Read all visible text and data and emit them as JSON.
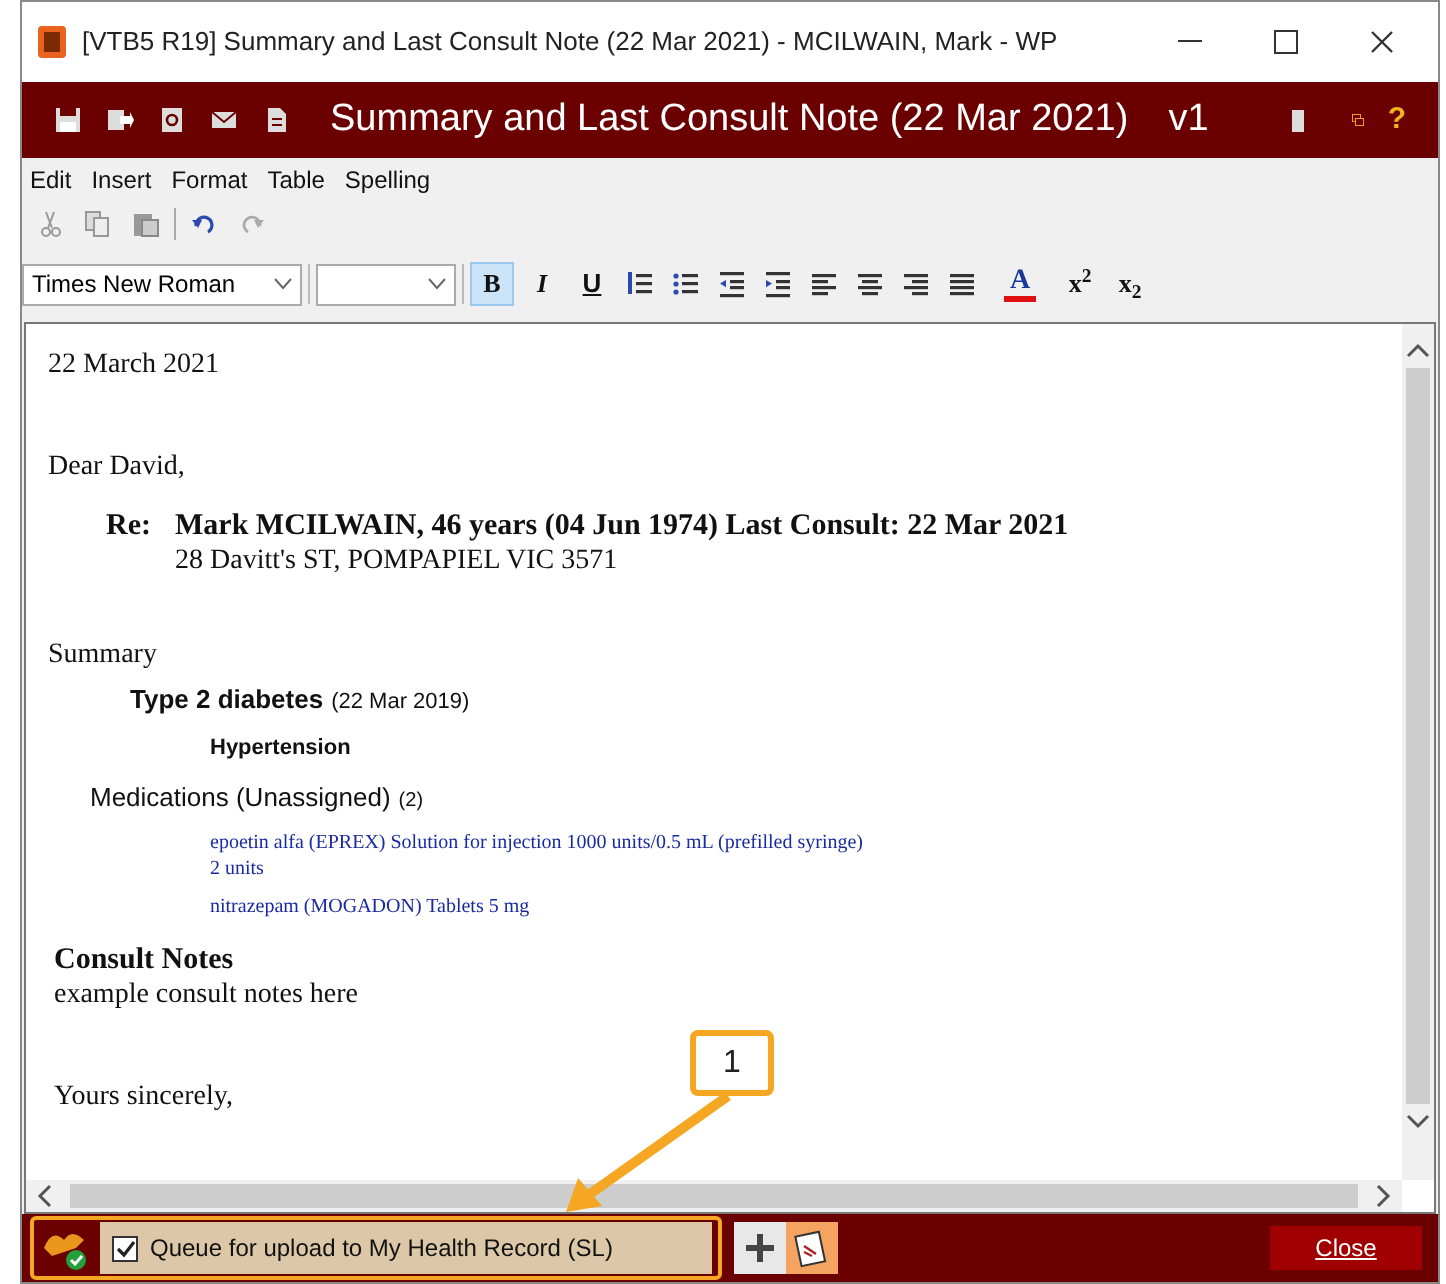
{
  "window": {
    "title": "[VTB5 R19] Summary and Last Consult Note (22 Mar 2021) - MCILWAIN, Mark - WP"
  },
  "header": {
    "title": "Summary and Last Consult Note (22 Mar 2021)",
    "version": "v1",
    "help": "?"
  },
  "menu": [
    {
      "label": "Edit"
    },
    {
      "label": "Insert"
    },
    {
      "label": "Format"
    },
    {
      "label": "Table"
    },
    {
      "label": "Spelling"
    }
  ],
  "format_bar": {
    "font": "Times New Roman",
    "buttons": [
      {
        "kind": "bold",
        "label": "B",
        "selected": true
      },
      {
        "kind": "italic",
        "label": "I",
        "selected": false
      },
      {
        "kind": "underline",
        "label": "U",
        "selected": false
      },
      {
        "kind": "lists"
      },
      {
        "kind": "color",
        "label": "A",
        "color": "#e01010"
      },
      {
        "kind": "bold",
        "label": "x$^{2}$",
        "selected": false
      },
      {
        "kind": "bold",
        "label": "x$_{2}$",
        "selected": false
      }
    ]
  },
  "document": {
    "date": "22 March 2021",
    "greeting": "Dear David,",
    "re": {
      "label": "Re:",
      "line": "Mark MCILWAIN, 46 years (04 Jun 1974) Last Consult: 22 Mar 2021",
      "address": "28 Davitt's ST, POMPAPIEL VIC 3571"
    },
    "summary": {
      "heading": "Summary",
      "conditions": [
        {
          "name": "Type 2 diabetes",
          "date": "(22 Mar 2019)",
          "children": [
            {
              "name": "Hypertension"
            }
          ]
        }
      ]
    },
    "medications": {
      "heading": "Medications (Unassigned)",
      "count": "(2)",
      "items": [
        {
          "name": "epoetin alfa (EPREX) Solution for injection 1000 units/0.5 mL (prefilled syringe)",
          "dose": "2 units"
        },
        {
          "name": "nitrazepam (MOGADON) Tablets 5 mg"
        }
      ]
    },
    "consult": {
      "heading": "Consult Notes",
      "text": "example consult notes here"
    },
    "closing": "Yours sincerely,"
  },
  "footer": {
    "checkbox": {
      "label": "Queue for upload to My Health Record (SL)",
      "checked": true
    },
    "close": "Close"
  },
  "callout": {
    "label": "1"
  }
}
